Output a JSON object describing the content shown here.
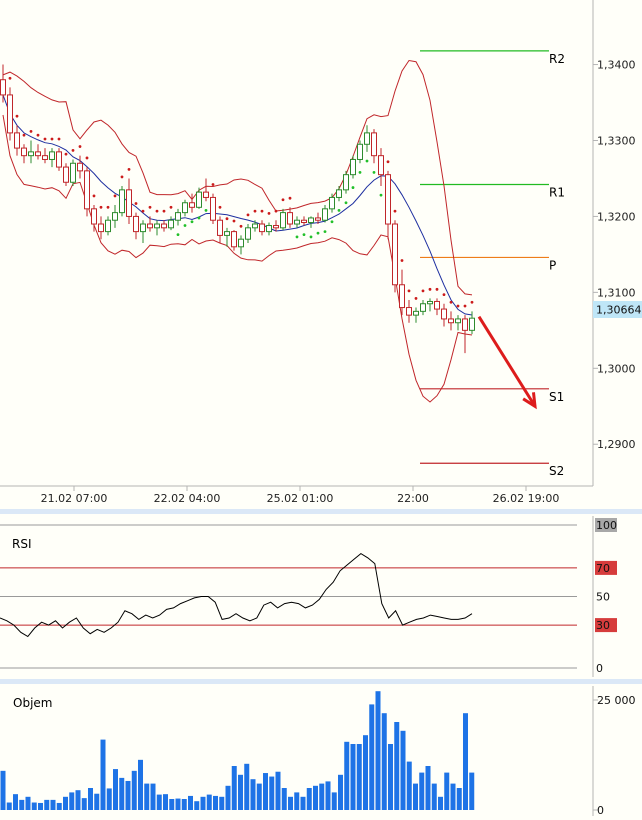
{
  "colors": {
    "background": "#fffff9",
    "separator": "#dbe8f7",
    "axis": "#b4b4b4",
    "candle_up": "#2e8b2e",
    "candle_down": "#c0262a",
    "bollinger": "#c0262a",
    "moving_average": "#1e2fa0",
    "sar_down": "#cc1c1c",
    "sar_up": "#22c02a",
    "resistance": "#22bb22",
    "pivot": "#ee7d1a",
    "support": "#c0262a",
    "forecast_arrow": "#dd1c1c",
    "price_tag": "#bfe6f7",
    "rsi_line": "#000000",
    "volume": "#1e73e6",
    "badge_gray": "#a8a8a8",
    "badge_red": "#d63c3c"
  },
  "chart_data": [
    {
      "type": "candlestick",
      "x_ticks": [
        "21.02 07:00",
        "22.02 04:00",
        "25.02 01:00",
        "22:00",
        "26.02 19:00"
      ],
      "y_ticks": [
        "1,3400",
        "1,3300",
        "1,3200",
        "1,3100",
        "1,3000",
        "1,2900"
      ],
      "ylim": [
        1.2845,
        1.3485
      ],
      "current_price": {
        "label": "1,30664",
        "value": 1.30664
      },
      "levels": [
        {
          "label": "R2",
          "value": 1.3418,
          "kind": "resistance"
        },
        {
          "label": "R1",
          "value": 1.3242,
          "kind": "resistance"
        },
        {
          "label": "P",
          "value": 1.3146,
          "kind": "pivot"
        },
        {
          "label": "S1",
          "value": 1.2973,
          "kind": "support"
        },
        {
          "label": "S2",
          "value": 1.2875,
          "kind": "support"
        }
      ],
      "forecast": {
        "from": [
          68,
          1.3068
        ],
        "to": [
          76,
          1.295
        ]
      },
      "candles": [
        [
          1.338,
          1.34,
          1.335,
          1.336
        ],
        [
          1.336,
          1.337,
          1.33,
          1.331
        ],
        [
          1.331,
          1.332,
          1.328,
          1.329
        ],
        [
          1.329,
          1.3295,
          1.327,
          1.328
        ],
        [
          1.328,
          1.33,
          1.327,
          1.3285
        ],
        [
          1.3285,
          1.3295,
          1.3275,
          1.328
        ],
        [
          1.328,
          1.329,
          1.327,
          1.3275
        ],
        [
          1.3275,
          1.329,
          1.3265,
          1.3285
        ],
        [
          1.3285,
          1.329,
          1.326,
          1.3265
        ],
        [
          1.3265,
          1.327,
          1.324,
          1.3245
        ],
        [
          1.3245,
          1.3275,
          1.324,
          1.327
        ],
        [
          1.327,
          1.328,
          1.325,
          1.326
        ],
        [
          1.326,
          1.3265,
          1.32,
          1.321
        ],
        [
          1.321,
          1.3215,
          1.318,
          1.319
        ],
        [
          1.319,
          1.32,
          1.317,
          1.318
        ],
        [
          1.318,
          1.32,
          1.3175,
          1.3195
        ],
        [
          1.3195,
          1.3215,
          1.3185,
          1.3205
        ],
        [
          1.3205,
          1.324,
          1.32,
          1.3235
        ],
        [
          1.3235,
          1.325,
          1.319,
          1.32
        ],
        [
          1.32,
          1.3205,
          1.317,
          1.318
        ],
        [
          1.318,
          1.3195,
          1.3165,
          1.319
        ],
        [
          1.319,
          1.32,
          1.318,
          1.3185
        ],
        [
          1.3185,
          1.3195,
          1.3175,
          1.319
        ],
        [
          1.319,
          1.3195,
          1.318,
          1.3185
        ],
        [
          1.3185,
          1.32,
          1.3182,
          1.3195
        ],
        [
          1.3195,
          1.321,
          1.3188,
          1.3205
        ],
        [
          1.3205,
          1.3222,
          1.32,
          1.3218
        ],
        [
          1.3218,
          1.323,
          1.3205,
          1.3212
        ],
        [
          1.3212,
          1.3238,
          1.321,
          1.3232
        ],
        [
          1.3232,
          1.325,
          1.322,
          1.3225
        ],
        [
          1.3225,
          1.323,
          1.319,
          1.3195
        ],
        [
          1.3195,
          1.32,
          1.3165,
          1.3175
        ],
        [
          1.3175,
          1.3185,
          1.316,
          1.318
        ],
        [
          1.318,
          1.3182,
          1.3155,
          1.316
        ],
        [
          1.316,
          1.3175,
          1.315,
          1.317
        ],
        [
          1.317,
          1.319,
          1.3165,
          1.3185
        ],
        [
          1.3185,
          1.3195,
          1.318,
          1.319
        ],
        [
          1.319,
          1.3195,
          1.3175,
          1.318
        ],
        [
          1.318,
          1.3192,
          1.3175,
          1.3188
        ],
        [
          1.3188,
          1.3195,
          1.318,
          1.3185
        ],
        [
          1.3185,
          1.321,
          1.3182,
          1.3205
        ],
        [
          1.3205,
          1.3212,
          1.3185,
          1.319
        ],
        [
          1.319,
          1.32,
          1.3185,
          1.3195
        ],
        [
          1.3195,
          1.32,
          1.3188,
          1.3192
        ],
        [
          1.3192,
          1.32,
          1.3185,
          1.3198
        ],
        [
          1.3198,
          1.3205,
          1.319,
          1.3195
        ],
        [
          1.3195,
          1.3215,
          1.3192,
          1.321
        ],
        [
          1.321,
          1.323,
          1.3205,
          1.3225
        ],
        [
          1.3225,
          1.324,
          1.322,
          1.3235
        ],
        [
          1.3235,
          1.326,
          1.323,
          1.3255
        ],
        [
          1.3255,
          1.328,
          1.325,
          1.3275
        ],
        [
          1.3275,
          1.33,
          1.327,
          1.3295
        ],
        [
          1.3295,
          1.332,
          1.3285,
          1.331
        ],
        [
          1.331,
          1.3315,
          1.327,
          1.328
        ],
        [
          1.328,
          1.329,
          1.324,
          1.3255
        ],
        [
          1.3255,
          1.326,
          1.317,
          1.319
        ],
        [
          1.319,
          1.3195,
          1.31,
          1.311
        ],
        [
          1.311,
          1.313,
          1.307,
          1.308
        ],
        [
          1.308,
          1.309,
          1.306,
          1.307
        ],
        [
          1.307,
          1.308,
          1.306,
          1.3075
        ],
        [
          1.3075,
          1.309,
          1.307,
          1.3085
        ],
        [
          1.3085,
          1.3092,
          1.3075,
          1.3088
        ],
        [
          1.3088,
          1.3092,
          1.307,
          1.3078
        ],
        [
          1.3078,
          1.3085,
          1.3055,
          1.3065
        ],
        [
          1.3065,
          1.3075,
          1.305,
          1.306
        ],
        [
          1.306,
          1.307,
          1.305,
          1.3065
        ],
        [
          1.3065,
          1.307,
          1.302,
          1.305
        ],
        [
          1.305,
          1.3075,
          1.3045,
          1.3066
        ]
      ]
    },
    {
      "type": "line",
      "title": "RSI",
      "ylim": [
        0,
        100
      ],
      "y_ticks": [
        "100",
        "70",
        "50",
        "30",
        "0"
      ],
      "levels": [
        70,
        30
      ],
      "values": [
        35,
        33,
        30,
        25,
        22,
        28,
        32,
        30,
        33,
        28,
        32,
        35,
        28,
        24,
        27,
        25,
        28,
        32,
        40,
        38,
        34,
        37,
        35,
        37,
        41,
        42,
        45,
        47,
        49,
        50,
        50,
        46,
        34,
        35,
        38,
        35,
        33,
        35,
        44,
        46,
        42,
        45,
        46,
        45,
        42,
        44,
        48,
        55,
        60,
        68,
        72,
        76,
        80,
        77,
        73,
        45,
        35,
        40,
        30,
        32,
        34,
        35,
        37,
        36,
        35,
        34,
        34,
        35,
        38
      ]
    },
    {
      "type": "bar",
      "title": "Objem",
      "ylim": [
        0,
        25000
      ],
      "y_ticks": [
        "25 000",
        "0"
      ],
      "values": [
        8900,
        1700,
        3600,
        2300,
        3000,
        1700,
        1600,
        2300,
        2300,
        1600,
        3000,
        4000,
        4500,
        2700,
        5000,
        3700,
        16000,
        4900,
        9300,
        7300,
        6600,
        8900,
        11400,
        6000,
        6000,
        3500,
        3600,
        2500,
        2600,
        2500,
        3200,
        2000,
        3000,
        3500,
        3200,
        3000,
        5500,
        10000,
        8000,
        10500,
        7000,
        6000,
        8400,
        7600,
        8700,
        5000,
        3000,
        4000,
        3000,
        5000,
        5500,
        6000,
        6500,
        4000,
        8000,
        15500,
        15000,
        15000,
        17000,
        24000,
        27000,
        22000,
        15000,
        20000,
        18000,
        11000,
        6000,
        8500,
        10000,
        6000,
        3000,
        8500,
        6000,
        5000,
        22000,
        8500
      ]
    }
  ]
}
